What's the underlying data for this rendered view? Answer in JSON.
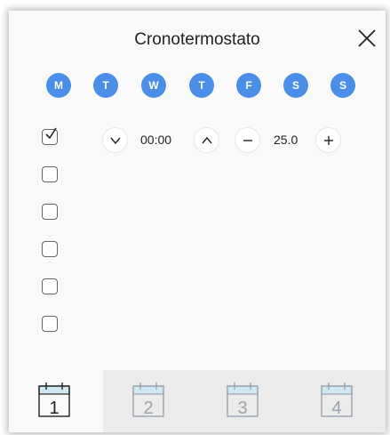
{
  "window": {
    "title": "Cronotermostato"
  },
  "days": [
    "M",
    "T",
    "W",
    "T",
    "F",
    "S",
    "S"
  ],
  "row": {
    "time": "00:00",
    "temperature": "25.0"
  },
  "checkboxes": [
    true,
    false,
    false,
    false,
    false,
    false
  ],
  "tabs": [
    {
      "number": "1",
      "active": true
    },
    {
      "number": "2",
      "active": false
    },
    {
      "number": "3",
      "active": false
    },
    {
      "number": "4",
      "active": false
    }
  ],
  "icons": {
    "close": "close-icon",
    "time_down": "chevron-down-icon",
    "time_up": "chevron-up-icon",
    "temp_down": "minus-icon",
    "temp_up": "plus-icon",
    "tab": "calendar-icon"
  },
  "colors": {
    "day_bubble": "#4a8ee8",
    "tab_inactive": "#ebebeb",
    "tab_icon_inactive": "#9aa4ad",
    "tab_icon_active": "#222222",
    "calendar_header": "#cfe6f3"
  }
}
